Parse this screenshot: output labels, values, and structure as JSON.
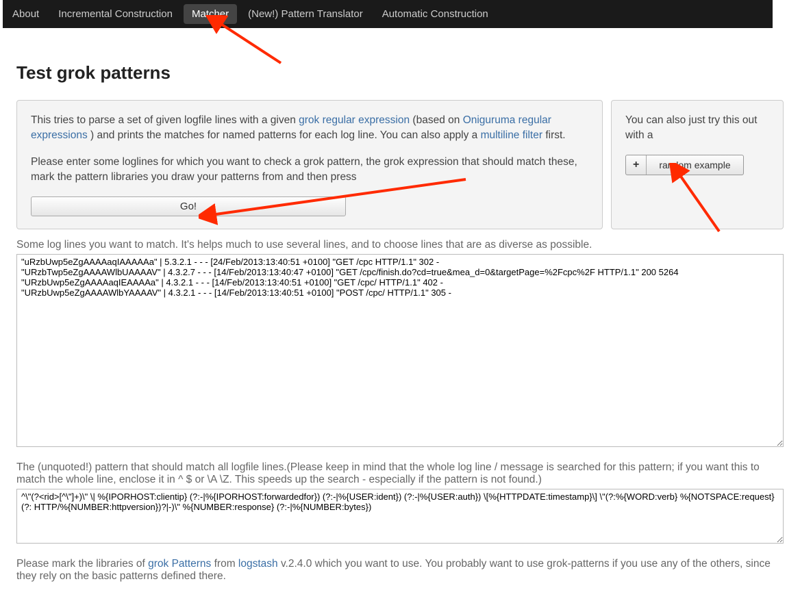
{
  "nav": {
    "items": [
      {
        "label": "About"
      },
      {
        "label": "Incremental Construction"
      },
      {
        "label": "Matcher"
      },
      {
        "label": "(New!) Pattern Translator"
      },
      {
        "label": "Automatic Construction"
      }
    ]
  },
  "page": {
    "title": "Test grok patterns"
  },
  "intro": {
    "p1_a": "This tries to parse a set of given logfile lines with a given ",
    "link1": "grok regular expression",
    "p1_b": " (based on ",
    "link2": "Oniguruma regular expressions",
    "p1_c": " ) and prints the matches for named patterns for each log line. You can also apply a ",
    "link3": "multiline filter",
    "p1_d": " first.",
    "p2": "Please enter some loglines for which you want to check a grok pattern, the grok expression that should match these, mark the pattern libraries you draw your patterns from and then press",
    "go_label": "Go!"
  },
  "side": {
    "text": "You can also just try this out with a",
    "plus": "+",
    "random_label": "random example"
  },
  "loglines": {
    "label": "Some log lines you want to match. It's helps much to use several lines, and to choose lines that are as diverse as possible.",
    "value": "\"uRzbUwp5eZgAAAAaqIAAAAAa\" | 5.3.2.1 - - - [24/Feb/2013:13:40:51 +0100] \"GET /cpc HTTP/1.1\" 302 -\n\"URzbTwp5eZgAAAAWlbUAAAAV\" | 4.3.2.7 - - - [14/Feb/2013:13:40:47 +0100] \"GET /cpc/finish.do?cd=true&mea_d=0&targetPage=%2Fcpc%2F HTTP/1.1\" 200 5264\n\"URzbUwp5eZgAAAAaqIEAAAAa\" | 4.3.2.1 - - - [14/Feb/2013:13:40:51 +0100] \"GET /cpc/ HTTP/1.1\" 402 -\n\"URzbUwp5eZgAAAAWlbYAAAAV\" | 4.3.2.1 - - - [14/Feb/2013:13:40:51 +0100] \"POST /cpc/ HTTP/1.1\" 305 -"
  },
  "pattern": {
    "label": "The (unquoted!) pattern that should match all logfile lines.(Please keep in mind that the whole log line / message is searched for this pattern; if you want this to match the whole line, enclose it in ^ $ or \\A \\Z. This speeds up the search - especially if the pattern is not found.)",
    "value": "^\\\"(?<rid>[^\\\"]+)\\\" \\| %{IPORHOST:clientip} (?:-|%{IPORHOST:forwardedfor}) (?:-|%{USER:ident}) (?:-|%{USER:auth}) \\[%{HTTPDATE:timestamp}\\] \\\"(?:%{WORD:verb} %{NOTSPACE:request}(?: HTTP/%{NUMBER:httpversion})?|-)\\\" %{NUMBER:response} (?:-|%{NUMBER:bytes})"
  },
  "libraries": {
    "text_a": "Please mark the libraries of ",
    "link1": "grok Patterns",
    "text_b": " from ",
    "link2": "logstash",
    "text_c": " v.2.4.0 which you want to use. You probably want to use grok-patterns if you use any of the others, since they rely on the basic patterns defined there."
  }
}
